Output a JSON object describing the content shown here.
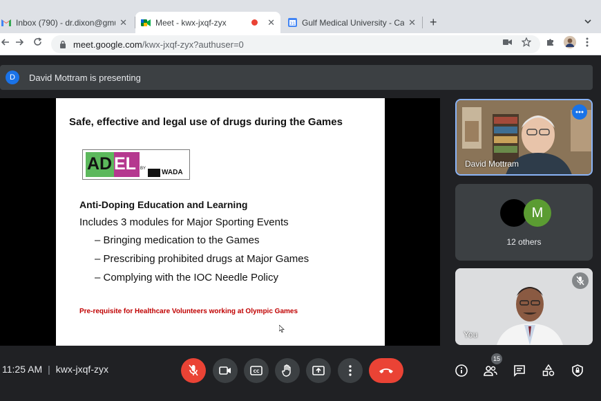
{
  "browser": {
    "tabs": [
      {
        "title": "Inbox (790) - dr.dixon@gmu.ac",
        "icon": "gmail-icon",
        "active": false
      },
      {
        "title": "Meet - kwx-jxqf-zyx",
        "icon": "meet-icon",
        "active": true
      },
      {
        "title": "Gulf Medical University - Calen",
        "icon": "calendar-icon",
        "active": false
      }
    ],
    "close_glyph": "✕",
    "newtab_glyph": "+",
    "url_host": "meet.google.com",
    "url_path": "/kwx-jxqf-zyx?authuser=0"
  },
  "meet": {
    "presenter_initial": "D",
    "presenter_text": "David Mottram is presenting",
    "slide": {
      "title": "Safe, effective and legal use of drugs during the Games",
      "logo": {
        "a_text": "AD",
        "e_text": "EL",
        "by": "BY",
        "wada": "WADA"
      },
      "subheading": "Anti-Doping Education and Learning",
      "intro": "Includes 3 modules for Major Sporting Events",
      "bullets": [
        "– Bringing medication to the Games",
        "– Prescribing prohibited drugs at Major Games",
        "– Complying with the IOC Needle Policy"
      ],
      "note": "Pre-requisite for Healthcare Volunteers working at Olympic Games"
    },
    "tiles": {
      "presenter_name": "David Mottram",
      "others_initial": "M",
      "others_label": "12 others",
      "self_label": "You"
    },
    "controls": {
      "time": "11:25 AM",
      "separator": "|",
      "meeting_code": "kwx-jxqf-zyx",
      "participant_count": "15"
    }
  }
}
